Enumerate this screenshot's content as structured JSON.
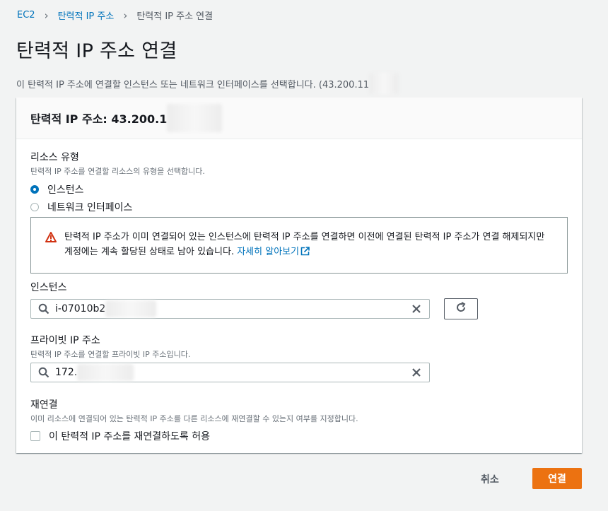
{
  "breadcrumb": {
    "items": [
      "EC2",
      "탄력적 IP 주소",
      "탄력적 IP 주소 연결"
    ]
  },
  "page": {
    "title": "탄력적 IP 주소 연결",
    "description": "이 탄력적 IP 주소에 연결할 인스턴스 또는 네트워크 인터페이스를 선택합니다. (43.200.11"
  },
  "panel": {
    "title": "탄력적 IP 주소: 43.200.1"
  },
  "resource_type": {
    "label": "리소스 유형",
    "hint": "탄력적 IP 주소를 연결할 리소스의 유형을 선택합니다.",
    "options": [
      {
        "label": "인스턴스",
        "selected": true
      },
      {
        "label": "네트워크 인터페이스",
        "selected": false
      }
    ]
  },
  "alert": {
    "text": "탄력적 IP 주소가 이미 연결되어 있는 인스턴스에 탄력적 IP 주소를 연결하면 이전에 연결된 탄력적 IP 주소가 연결 해제되지만 계정에는 계속 할당된 상태로 남아 있습니다. ",
    "link": "자세히 알아보기"
  },
  "instance": {
    "label": "인스턴스",
    "value": "i-07010b2"
  },
  "private_ip": {
    "label": "프라이빗 IP 주소",
    "hint": "탄력적 IP 주소를 연결할 프라이빗 IP 주소입니다.",
    "value": "172."
  },
  "reassociation": {
    "label": "재연결",
    "hint": "이미 리소스에 연결되어 있는 탄력적 IP 주소를 다른 리소스에 재연결할 수 있는지 여부를 지정합니다.",
    "checkbox_label": "이 탄력적 IP 주소를 재연결하도록 허용",
    "checked": false
  },
  "actions": {
    "cancel": "취소",
    "associate": "연결"
  },
  "colors": {
    "link": "#0073bb",
    "primary": "#ec7211",
    "warning": "#d13212"
  }
}
